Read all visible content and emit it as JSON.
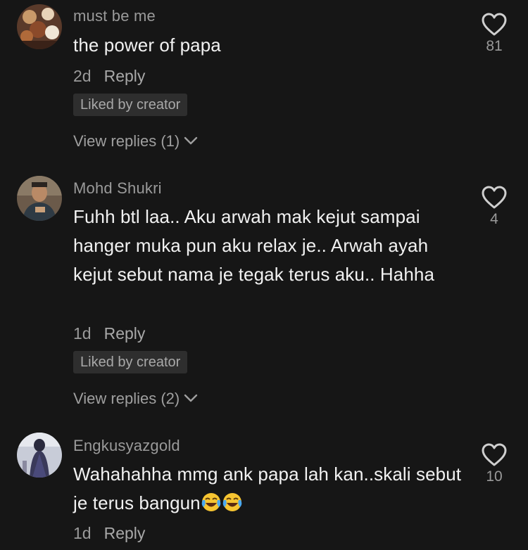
{
  "comments": [
    {
      "username": "must be me",
      "text": "the power of papa",
      "time": "2d",
      "reply_label": "Reply",
      "liked_badge": "Liked by creator",
      "view_replies": "View replies (1)",
      "like_count": "81"
    },
    {
      "username": "Mohd Shukri",
      "text": "Fuhh btl laa.. Aku arwah mak kejut sampai hanger muka pun aku relax je.. Arwah ayah kejut sebut nama je tegak terus aku.. Hahha",
      "time": "1d",
      "reply_label": "Reply",
      "liked_badge": "Liked by creator",
      "view_replies": "View replies (2)",
      "like_count": "4"
    },
    {
      "username": "Engkusyazgold",
      "text": "Wahahahha mmg ank papa lah kan..skali sebut je terus bangun",
      "time": "1d",
      "reply_label": "Reply",
      "like_count": "10",
      "emojis": [
        "face-with-tears-of-joy",
        "face-with-tears-of-joy"
      ]
    }
  ],
  "icons": {
    "like": "heart-outline-icon",
    "expand": "chevron-down-icon"
  },
  "colors": {
    "background": "#161616",
    "text": "#f1f1f1",
    "secondary_text": "#9a9a9a",
    "badge_bg": "#2e2e2e"
  }
}
